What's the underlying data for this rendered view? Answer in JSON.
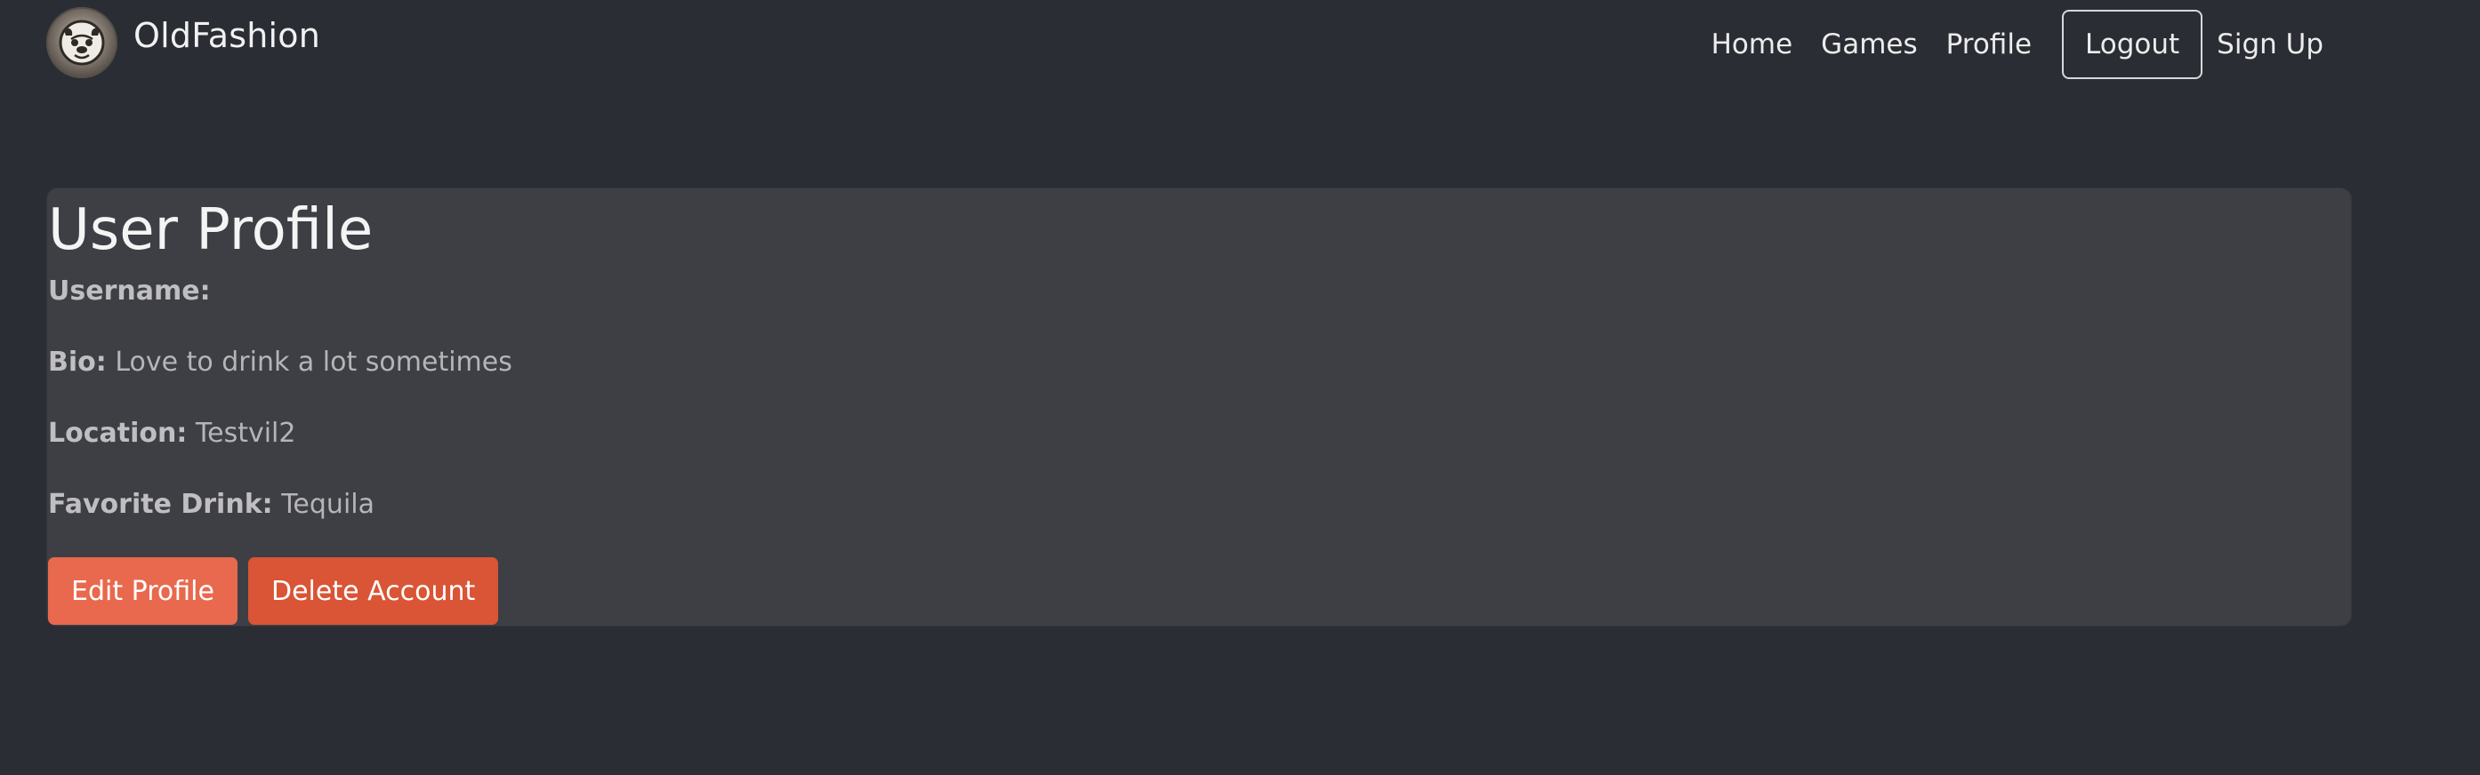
{
  "navbar": {
    "brand": "OldFashion",
    "links": {
      "home": "Home",
      "games": "Games",
      "profile": "Profile",
      "logout": "Logout",
      "signup": "Sign Up"
    }
  },
  "profile": {
    "title": "User Profile",
    "username_label": "Username:",
    "username_value": "",
    "bio_label": "Bio:",
    "bio_value": "Love to drink a lot sometimes",
    "location_label": "Location:",
    "location_value": "Testvil2",
    "drink_label": "Favorite Drink:",
    "drink_value": "Tequila",
    "edit_button": "Edit Profile",
    "delete_button": "Delete Account"
  },
  "colors": {
    "background": "#2a2d34",
    "card": "#3e3f45",
    "edit_button": "#e8694d",
    "delete_button": "#d95535"
  },
  "icons": {
    "brand_logo": "pug-logo-icon"
  }
}
